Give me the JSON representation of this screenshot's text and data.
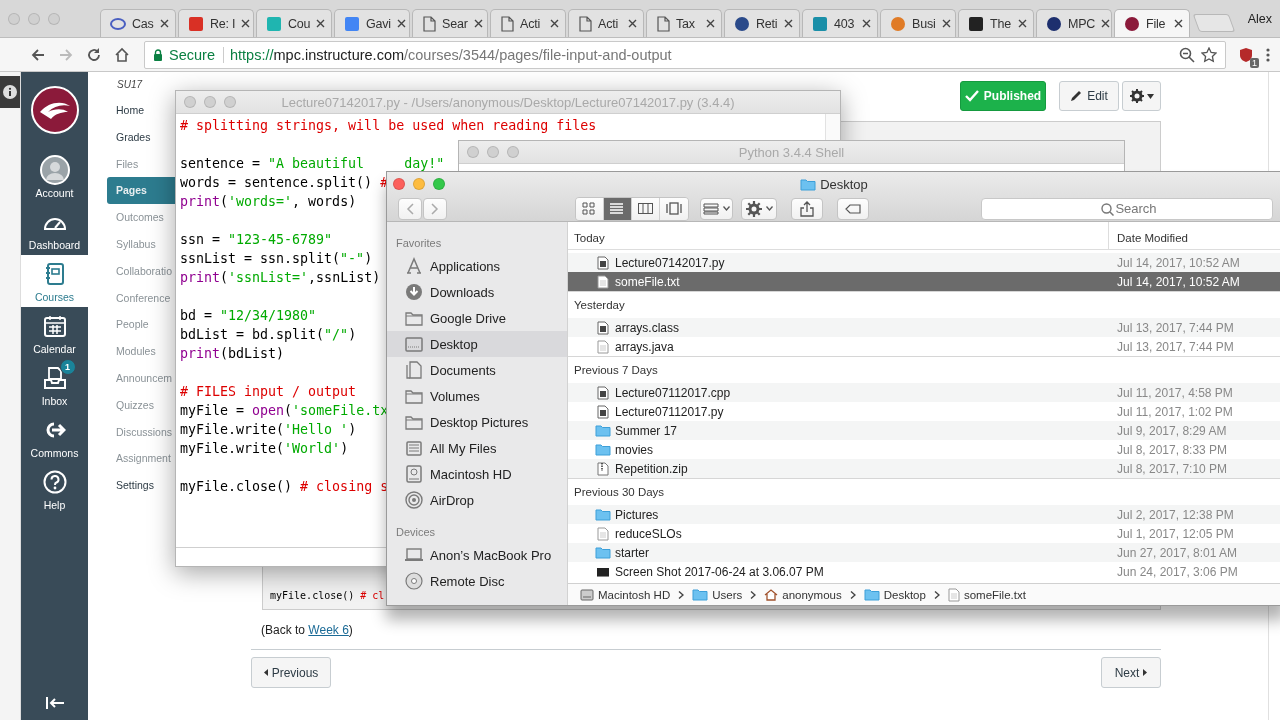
{
  "browser": {
    "tabs": [
      {
        "title": "Cas",
        "kind": "ring",
        "color": "#4a5fc1",
        "selected": false
      },
      {
        "title": "Re: I",
        "kind": "square",
        "color": "#d93025",
        "selected": false
      },
      {
        "title": "Cou",
        "kind": "square",
        "color": "#1fb5b0",
        "selected": false
      },
      {
        "title": "Gavi",
        "kind": "square",
        "color": "#4285f4",
        "selected": false
      },
      {
        "title": "Sear",
        "kind": "page",
        "selected": false
      },
      {
        "title": "Acti",
        "kind": "page",
        "selected": false
      },
      {
        "title": "Acti",
        "kind": "page",
        "selected": false
      },
      {
        "title": "Tax",
        "kind": "page",
        "selected": false
      },
      {
        "title": "Reti",
        "kind": "circle",
        "color": "#2a4a8a",
        "selected": false
      },
      {
        "title": "403",
        "kind": "square",
        "color": "#1a8fa8",
        "selected": false
      },
      {
        "title": "Busi",
        "kind": "circle",
        "color": "#e07b26",
        "selected": false
      },
      {
        "title": "The",
        "kind": "square",
        "color": "#222222",
        "selected": false
      },
      {
        "title": "MPC",
        "kind": "circle",
        "color": "#1d2f6e",
        "selected": false
      },
      {
        "title": "File",
        "kind": "circle",
        "color": "#8b1a3a",
        "selected": true
      }
    ],
    "profile": "Alex",
    "address": {
      "security": "Secure",
      "scheme": "https://",
      "host": "mpc.instructure.com",
      "path": "/courses/3544/pages/file-input-and-output"
    },
    "extension_badge": "1"
  },
  "global_nav": {
    "items": [
      {
        "label": "Account",
        "kind": "avatar",
        "selected": false
      },
      {
        "label": "Dashboard",
        "kind": "gauge",
        "selected": false
      },
      {
        "label": "Courses",
        "kind": "notebook",
        "selected": true
      },
      {
        "label": "Calendar",
        "kind": "calendar",
        "selected": false
      },
      {
        "label": "Inbox",
        "kind": "inbox",
        "selected": false,
        "badge": "1"
      },
      {
        "label": "Commons",
        "kind": "commons",
        "selected": false
      },
      {
        "label": "Help",
        "kind": "help",
        "selected": false
      }
    ]
  },
  "course_nav": {
    "term": "SU17",
    "items": [
      {
        "label": "Home",
        "hidden": false,
        "selected": false
      },
      {
        "label": "Grades",
        "hidden": false,
        "selected": false
      },
      {
        "label": "Files",
        "hidden": true,
        "selected": false
      },
      {
        "label": "Pages",
        "hidden": false,
        "selected": true
      },
      {
        "label": "Outcomes",
        "hidden": true,
        "selected": false
      },
      {
        "label": "Syllabus",
        "hidden": true,
        "selected": false
      },
      {
        "label": "Collaboratio",
        "hidden": true,
        "selected": false
      },
      {
        "label": "Conference",
        "hidden": true,
        "selected": false
      },
      {
        "label": "People",
        "hidden": true,
        "selected": false
      },
      {
        "label": "Modules",
        "hidden": true,
        "selected": false
      },
      {
        "label": "Announcem",
        "hidden": true,
        "selected": false
      },
      {
        "label": "Quizzes",
        "hidden": true,
        "selected": false
      },
      {
        "label": "Discussions",
        "hidden": true,
        "selected": false
      },
      {
        "label": "Assignment",
        "hidden": true,
        "selected": false
      },
      {
        "label": "Settings",
        "hidden": false,
        "selected": false
      }
    ]
  },
  "page": {
    "status": "Published",
    "edit": "Edit",
    "code_tail": [
      {
        "kind": "plain",
        "text": "myFile.close() "
      },
      {
        "kind": "comment",
        "text": "# cl"
      }
    ],
    "back": {
      "before": "(Back to ",
      "link": "Week 6",
      "after": ")"
    },
    "previous": "Previous",
    "next": "Next"
  },
  "editor": {
    "title": "Lecture07142017.py - /Users/anonymous/Desktop/Lecture07142017.py (3.4.4)",
    "active": false,
    "lines": [
      {
        "kind": "code",
        "segments": [
          {
            "kind": "comment",
            "text": "# splitting strings, will be used when reading files"
          }
        ]
      },
      {
        "kind": "blank"
      },
      {
        "kind": "code",
        "segments": [
          {
            "kind": "plain",
            "text": "sentence = "
          },
          {
            "kind": "string",
            "text": "\"A beautiful     day!\""
          }
        ]
      },
      {
        "kind": "code",
        "segments": [
          {
            "kind": "plain",
            "text": "words = sentence.split() "
          },
          {
            "kind": "comment",
            "text": "#"
          }
        ]
      },
      {
        "kind": "code",
        "segments": [
          {
            "kind": "builtin",
            "text": "print"
          },
          {
            "kind": "plain",
            "text": "("
          },
          {
            "kind": "string",
            "text": "'words='"
          },
          {
            "kind": "plain",
            "text": ", words)"
          }
        ]
      },
      {
        "kind": "blank"
      },
      {
        "kind": "code",
        "segments": [
          {
            "kind": "plain",
            "text": "ssn = "
          },
          {
            "kind": "string",
            "text": "\"123-45-6789\""
          }
        ]
      },
      {
        "kind": "code",
        "segments": [
          {
            "kind": "plain",
            "text": "ssnList = ssn.split("
          },
          {
            "kind": "string",
            "text": "\"-\""
          },
          {
            "kind": "plain",
            "text": ")"
          }
        ]
      },
      {
        "kind": "code",
        "segments": [
          {
            "kind": "builtin",
            "text": "print"
          },
          {
            "kind": "plain",
            "text": "("
          },
          {
            "kind": "string",
            "text": "'ssnList='"
          },
          {
            "kind": "plain",
            "text": ",ssnList)"
          }
        ]
      },
      {
        "kind": "blank"
      },
      {
        "kind": "code",
        "segments": [
          {
            "kind": "plain",
            "text": "bd = "
          },
          {
            "kind": "string",
            "text": "\"12/34/1980\""
          }
        ]
      },
      {
        "kind": "code",
        "segments": [
          {
            "kind": "plain",
            "text": "bdList = bd.split("
          },
          {
            "kind": "string",
            "text": "\"/\""
          },
          {
            "kind": "plain",
            "text": ")"
          }
        ]
      },
      {
        "kind": "code",
        "segments": [
          {
            "kind": "builtin",
            "text": "print"
          },
          {
            "kind": "plain",
            "text": "(bdList)"
          }
        ]
      },
      {
        "kind": "blank"
      },
      {
        "kind": "code",
        "segments": [
          {
            "kind": "comment",
            "text": "# FILES input / output"
          }
        ]
      },
      {
        "kind": "code",
        "segments": [
          {
            "kind": "plain",
            "text": "myFile = "
          },
          {
            "kind": "builtin",
            "text": "open"
          },
          {
            "kind": "plain",
            "text": "("
          },
          {
            "kind": "string",
            "text": "'someFile.tx"
          }
        ]
      },
      {
        "kind": "code",
        "segments": [
          {
            "kind": "plain",
            "text": "myFile.write("
          },
          {
            "kind": "string",
            "text": "'Hello '"
          },
          {
            "kind": "plain",
            "text": ")"
          }
        ]
      },
      {
        "kind": "code",
        "segments": [
          {
            "kind": "plain",
            "text": "myFile.write("
          },
          {
            "kind": "string",
            "text": "'World'"
          },
          {
            "kind": "plain",
            "text": ")"
          }
        ]
      },
      {
        "kind": "blank"
      },
      {
        "kind": "code",
        "segments": [
          {
            "kind": "plain",
            "text": "myFile.close() "
          },
          {
            "kind": "comment",
            "text": "# closing s"
          }
        ]
      }
    ]
  },
  "shell": {
    "title": "Python 3.4.4 Shell",
    "active": false
  },
  "finder": {
    "title": "Desktop",
    "active": true,
    "view_modes": [
      {
        "kind": "icons",
        "selected": false
      },
      {
        "kind": "list",
        "selected": true
      },
      {
        "kind": "columns",
        "selected": false
      },
      {
        "kind": "coverflow",
        "selected": false
      }
    ],
    "search_placeholder": "Search",
    "sidebar": [
      {
        "heading": "Favorites",
        "items": [
          {
            "label": "Applications",
            "kind": "apps",
            "selected": false
          },
          {
            "label": "Downloads",
            "kind": "download",
            "selected": false
          },
          {
            "label": "Google Drive",
            "kind": "folder",
            "selected": false
          },
          {
            "label": "Desktop",
            "kind": "desktop",
            "selected": true
          },
          {
            "label": "Documents",
            "kind": "documents",
            "selected": false
          },
          {
            "label": "Volumes",
            "kind": "folder",
            "selected": false
          },
          {
            "label": "Desktop Pictures",
            "kind": "folder",
            "selected": false
          },
          {
            "label": "All My Files",
            "kind": "allfiles",
            "selected": false
          },
          {
            "label": "Macintosh HD",
            "kind": "disk",
            "selected": false
          },
          {
            "label": "AirDrop",
            "kind": "airdrop",
            "selected": false
          }
        ]
      },
      {
        "heading": "Devices",
        "items": [
          {
            "label": "Anon’s MacBook Pro",
            "kind": "laptop",
            "selected": false
          },
          {
            "label": "Remote Disc",
            "kind": "disc",
            "selected": false
          }
        ]
      }
    ],
    "date_column": "Date Modified",
    "groups": [
      {
        "label": "Today",
        "files": [
          {
            "name": "Lecture07142017.py",
            "kind": "script",
            "date": "Jul 14, 2017, 10:52 AM",
            "selected": false
          },
          {
            "name": "someFile.txt",
            "kind": "text",
            "date": "Jul 14, 2017, 10:52 AM",
            "selected": true
          }
        ]
      },
      {
        "label": "Yesterday",
        "files": [
          {
            "name": "arrays.class",
            "kind": "script",
            "date": "Jul 13, 2017, 7:44 PM",
            "selected": false
          },
          {
            "name": "arrays.java",
            "kind": "text",
            "date": "Jul 13, 2017, 7:44 PM",
            "selected": false
          }
        ]
      },
      {
        "label": "Previous 7 Days",
        "files": [
          {
            "name": "Lecture07112017.cpp",
            "kind": "script",
            "date": "Jul 11, 2017, 4:58 PM",
            "selected": false
          },
          {
            "name": "Lecture07112017.py",
            "kind": "script",
            "date": "Jul 11, 2017, 1:02 PM",
            "selected": false
          },
          {
            "name": "Summer 17",
            "kind": "folder",
            "date": "Jul 9, 2017, 8:29 AM",
            "selected": false
          },
          {
            "name": "movies",
            "kind": "folder",
            "date": "Jul 8, 2017, 8:33 PM",
            "selected": false
          },
          {
            "name": "Repetition.zip",
            "kind": "zip",
            "date": "Jul 8, 2017, 7:10 PM",
            "selected": false
          }
        ]
      },
      {
        "label": "Previous 30 Days",
        "files": [
          {
            "name": "Pictures",
            "kind": "folder",
            "date": "Jul 2, 2017, 12:38 PM",
            "selected": false
          },
          {
            "name": "reduceSLOs",
            "kind": "text",
            "date": "Jul 1, 2017, 12:05 PM",
            "selected": false
          },
          {
            "name": "starter",
            "kind": "folder",
            "date": "Jun 27, 2017, 8:01 AM",
            "selected": false
          },
          {
            "name": "Screen Shot 2017-06-24 at 3.06.07 PM",
            "kind": "image",
            "date": "Jun 24, 2017, 3:06 PM",
            "selected": false
          }
        ]
      }
    ],
    "path": [
      {
        "label": "Macintosh HD",
        "kind": "disk"
      },
      {
        "label": "Users",
        "kind": "folder"
      },
      {
        "label": "anonymous",
        "kind": "home"
      },
      {
        "label": "Desktop",
        "kind": "folder"
      },
      {
        "label": "someFile.txt",
        "kind": "text"
      }
    ]
  }
}
